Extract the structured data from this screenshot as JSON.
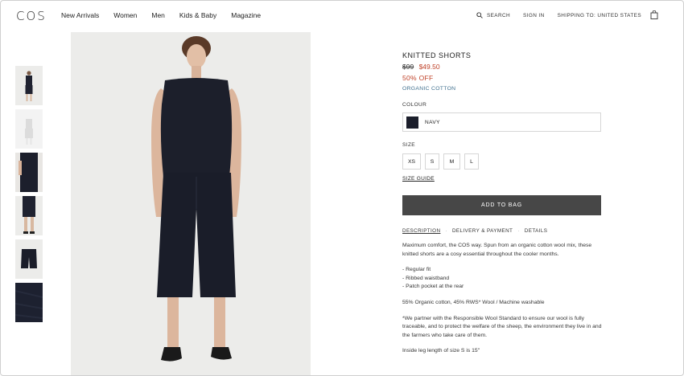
{
  "header": {
    "logo": "COS",
    "nav": [
      "New Arrivals",
      "Women",
      "Men",
      "Kids & Baby",
      "Magazine"
    ],
    "search_label": "SEARCH",
    "sign_in_label": "SIGN IN",
    "shipping_label": "SHIPPING TO: UNITED STATES"
  },
  "product": {
    "title": "KNITTED SHORTS",
    "old_price": "$99",
    "new_price": "$49.50",
    "discount": "50% OFF",
    "material": "ORGANIC COTTON",
    "colour_label": "COLOUR",
    "colour_name": "NAVY",
    "colour_hex": "#1b1e2b",
    "size_label": "SIZE",
    "sizes": [
      "XS",
      "S",
      "M",
      "L"
    ],
    "size_guide": "SIZE GUIDE",
    "add_to_bag": "ADD TO BAG"
  },
  "tabs": [
    "DESCRIPTION",
    "DELIVERY & PAYMENT",
    "DETAILS"
  ],
  "description": {
    "intro": "Maximum comfort, the COS way. Spun from an organic cotton wool mix, these knitted shorts are a cosy essential throughout the cooler months.",
    "bullets": [
      "- Regular fit",
      "- Ribbed waistband",
      "- Patch pocket at the rear"
    ],
    "composition": "55% Organic cotton, 45% RWS* Wool / Machine washable",
    "rws_note": "*We partner with the Responsible Wool Standard to ensure our wool is fully traceable, and to protect the welfare of the sheep, the environment they live in and the farmers who take care of them.",
    "leg_length": "Inside leg length of size S is 15\""
  },
  "colors": {
    "accent_sale": "#c0432a",
    "link_blue": "#3f6f8e",
    "button_bg": "#474747"
  }
}
